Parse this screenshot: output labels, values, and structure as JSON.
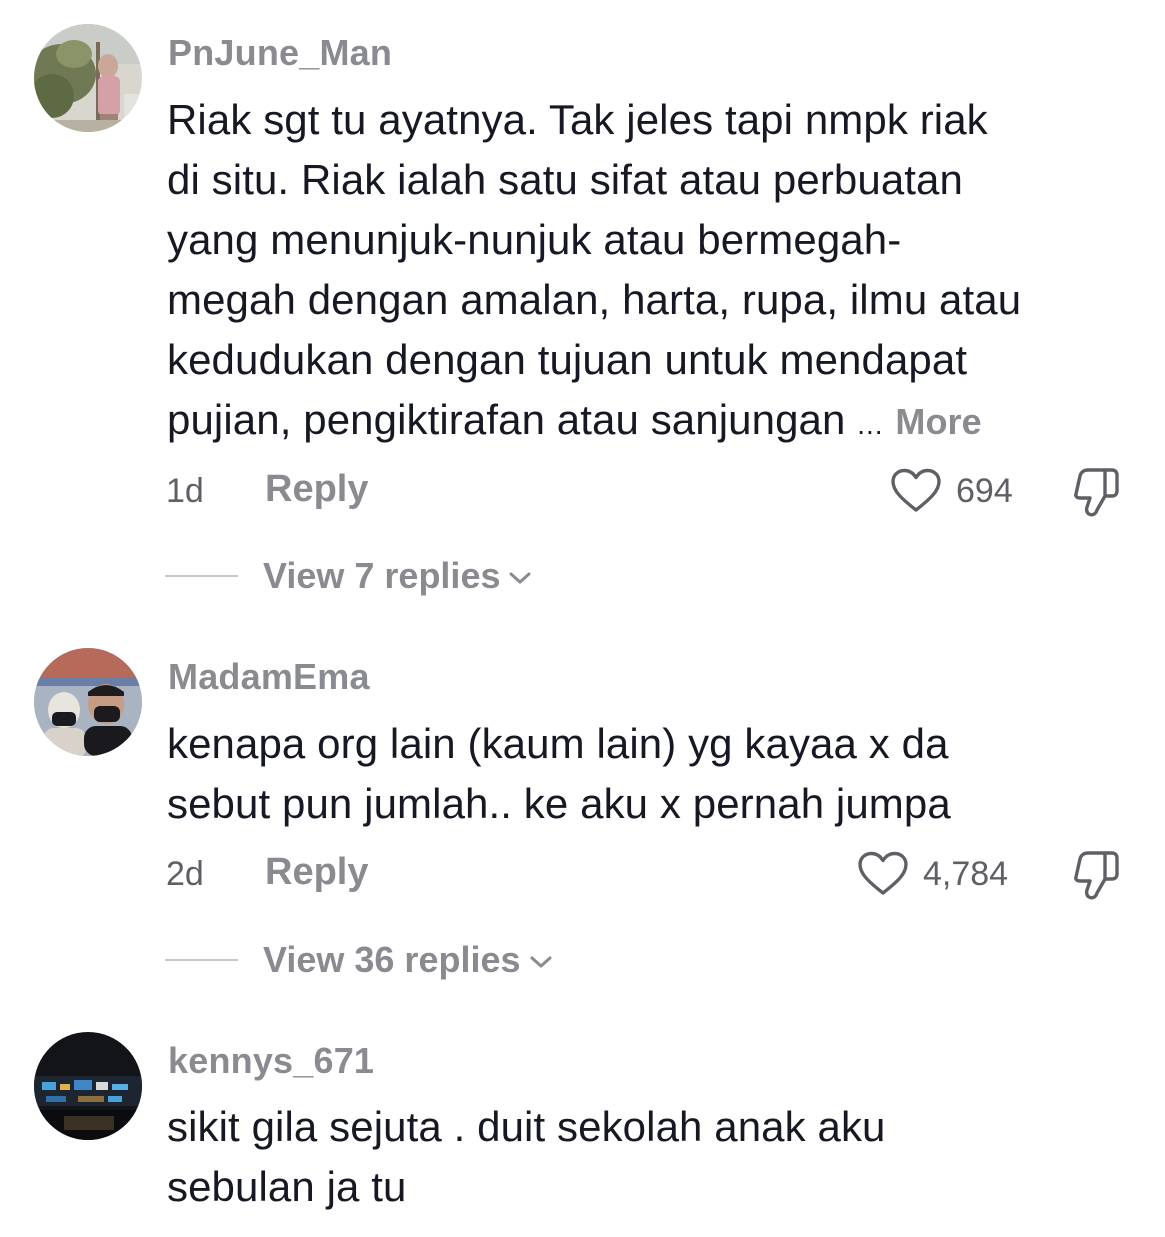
{
  "comments": [
    {
      "username": "PnJune_Man",
      "text_lines": [
        "Riak sgt tu ayatnya. Tak jeles tapi nmpk riak",
        "di situ. Riak ialah satu sifat atau perbuatan",
        "yang menunjuk-nunjuk atau bermegah-",
        "megah dengan amalan, harta, rupa, ilmu atau",
        "kedudukan dengan tujuan untuk mendapat",
        "pujian, pengiktirafan atau sanjungan"
      ],
      "ellipsis": "...",
      "more_label": "More",
      "time": "1d",
      "reply_label": "Reply",
      "likes": "694",
      "view_replies_label": "View 7 replies"
    },
    {
      "username": "MadamEma",
      "text_lines": [
        "kenapa org lain (kaum lain) yg kayaa x da",
        "sebut pun jumlah.. ke aku x pernah jumpa"
      ],
      "time": "2d",
      "reply_label": "Reply",
      "likes": "4,784",
      "view_replies_label": "View 36 replies"
    },
    {
      "username": "kennys_671",
      "text_lines": [
        "sikit gila sejuta . duit sekolah anak aku",
        "sebulan ja tu"
      ]
    }
  ],
  "icons": {
    "like": "heart-outline-icon",
    "dislike": "thumbs-down-icon",
    "expand": "chevron-down-icon"
  },
  "colors": {
    "text": "#161823",
    "secondary": "#8a8b91",
    "meta": "#5f6066"
  }
}
